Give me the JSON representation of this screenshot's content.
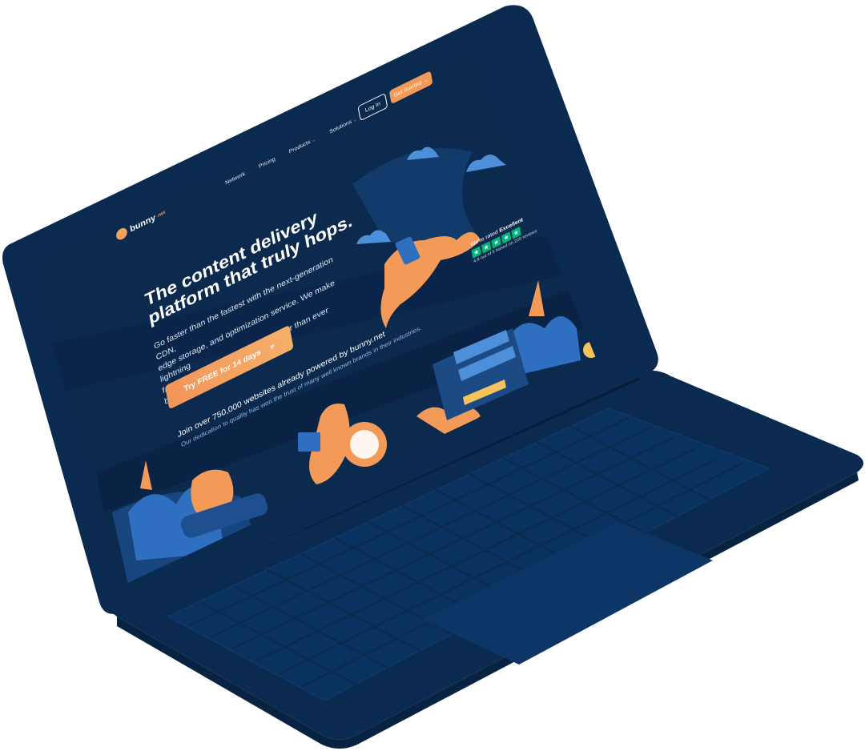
{
  "brand": {
    "logo_text": "bunny",
    "logo_suffix": ".net"
  },
  "nav": {
    "items": [
      {
        "label": "Network",
        "dropdown": false
      },
      {
        "label": "Pricing",
        "dropdown": false
      },
      {
        "label": "Products",
        "dropdown": true
      },
      {
        "label": "Solutions",
        "dropdown": true
      }
    ],
    "login_label": "Log In",
    "get_started_label": "Get Started →"
  },
  "hero": {
    "title_line1": "The content delivery",
    "title_line2": "platform that truly hops.",
    "subtitle_line1": "Go faster than the fastest with the next-generation CDN,",
    "subtitle_line2": "edge storage, and optimization service. We make lightning",
    "subtitle_line3": "fast performance at any scale easier than ever before.",
    "cta_label": "Try FREE for 14 days",
    "cta_arrow": "»"
  },
  "rating": {
    "prefix": "We're rated",
    "level": "Excellent",
    "stars": 5,
    "star_glyph": "★",
    "summary": "4.8 out of 5 based on 220 reviews"
  },
  "trust": {
    "headline": "Join over 750,000 websites already powered by bunny.net",
    "subline": "Our dedication to quality has won the trust of many well known brands in their industries."
  },
  "colors": {
    "page_bg": "#ffffff",
    "laptop_body": "#0b2a4f",
    "screen_bg": "#0c2a4e",
    "accent_orange": "#f39a58",
    "trustpilot_green": "#00b67a",
    "link_blue": "#8fb8e6"
  }
}
